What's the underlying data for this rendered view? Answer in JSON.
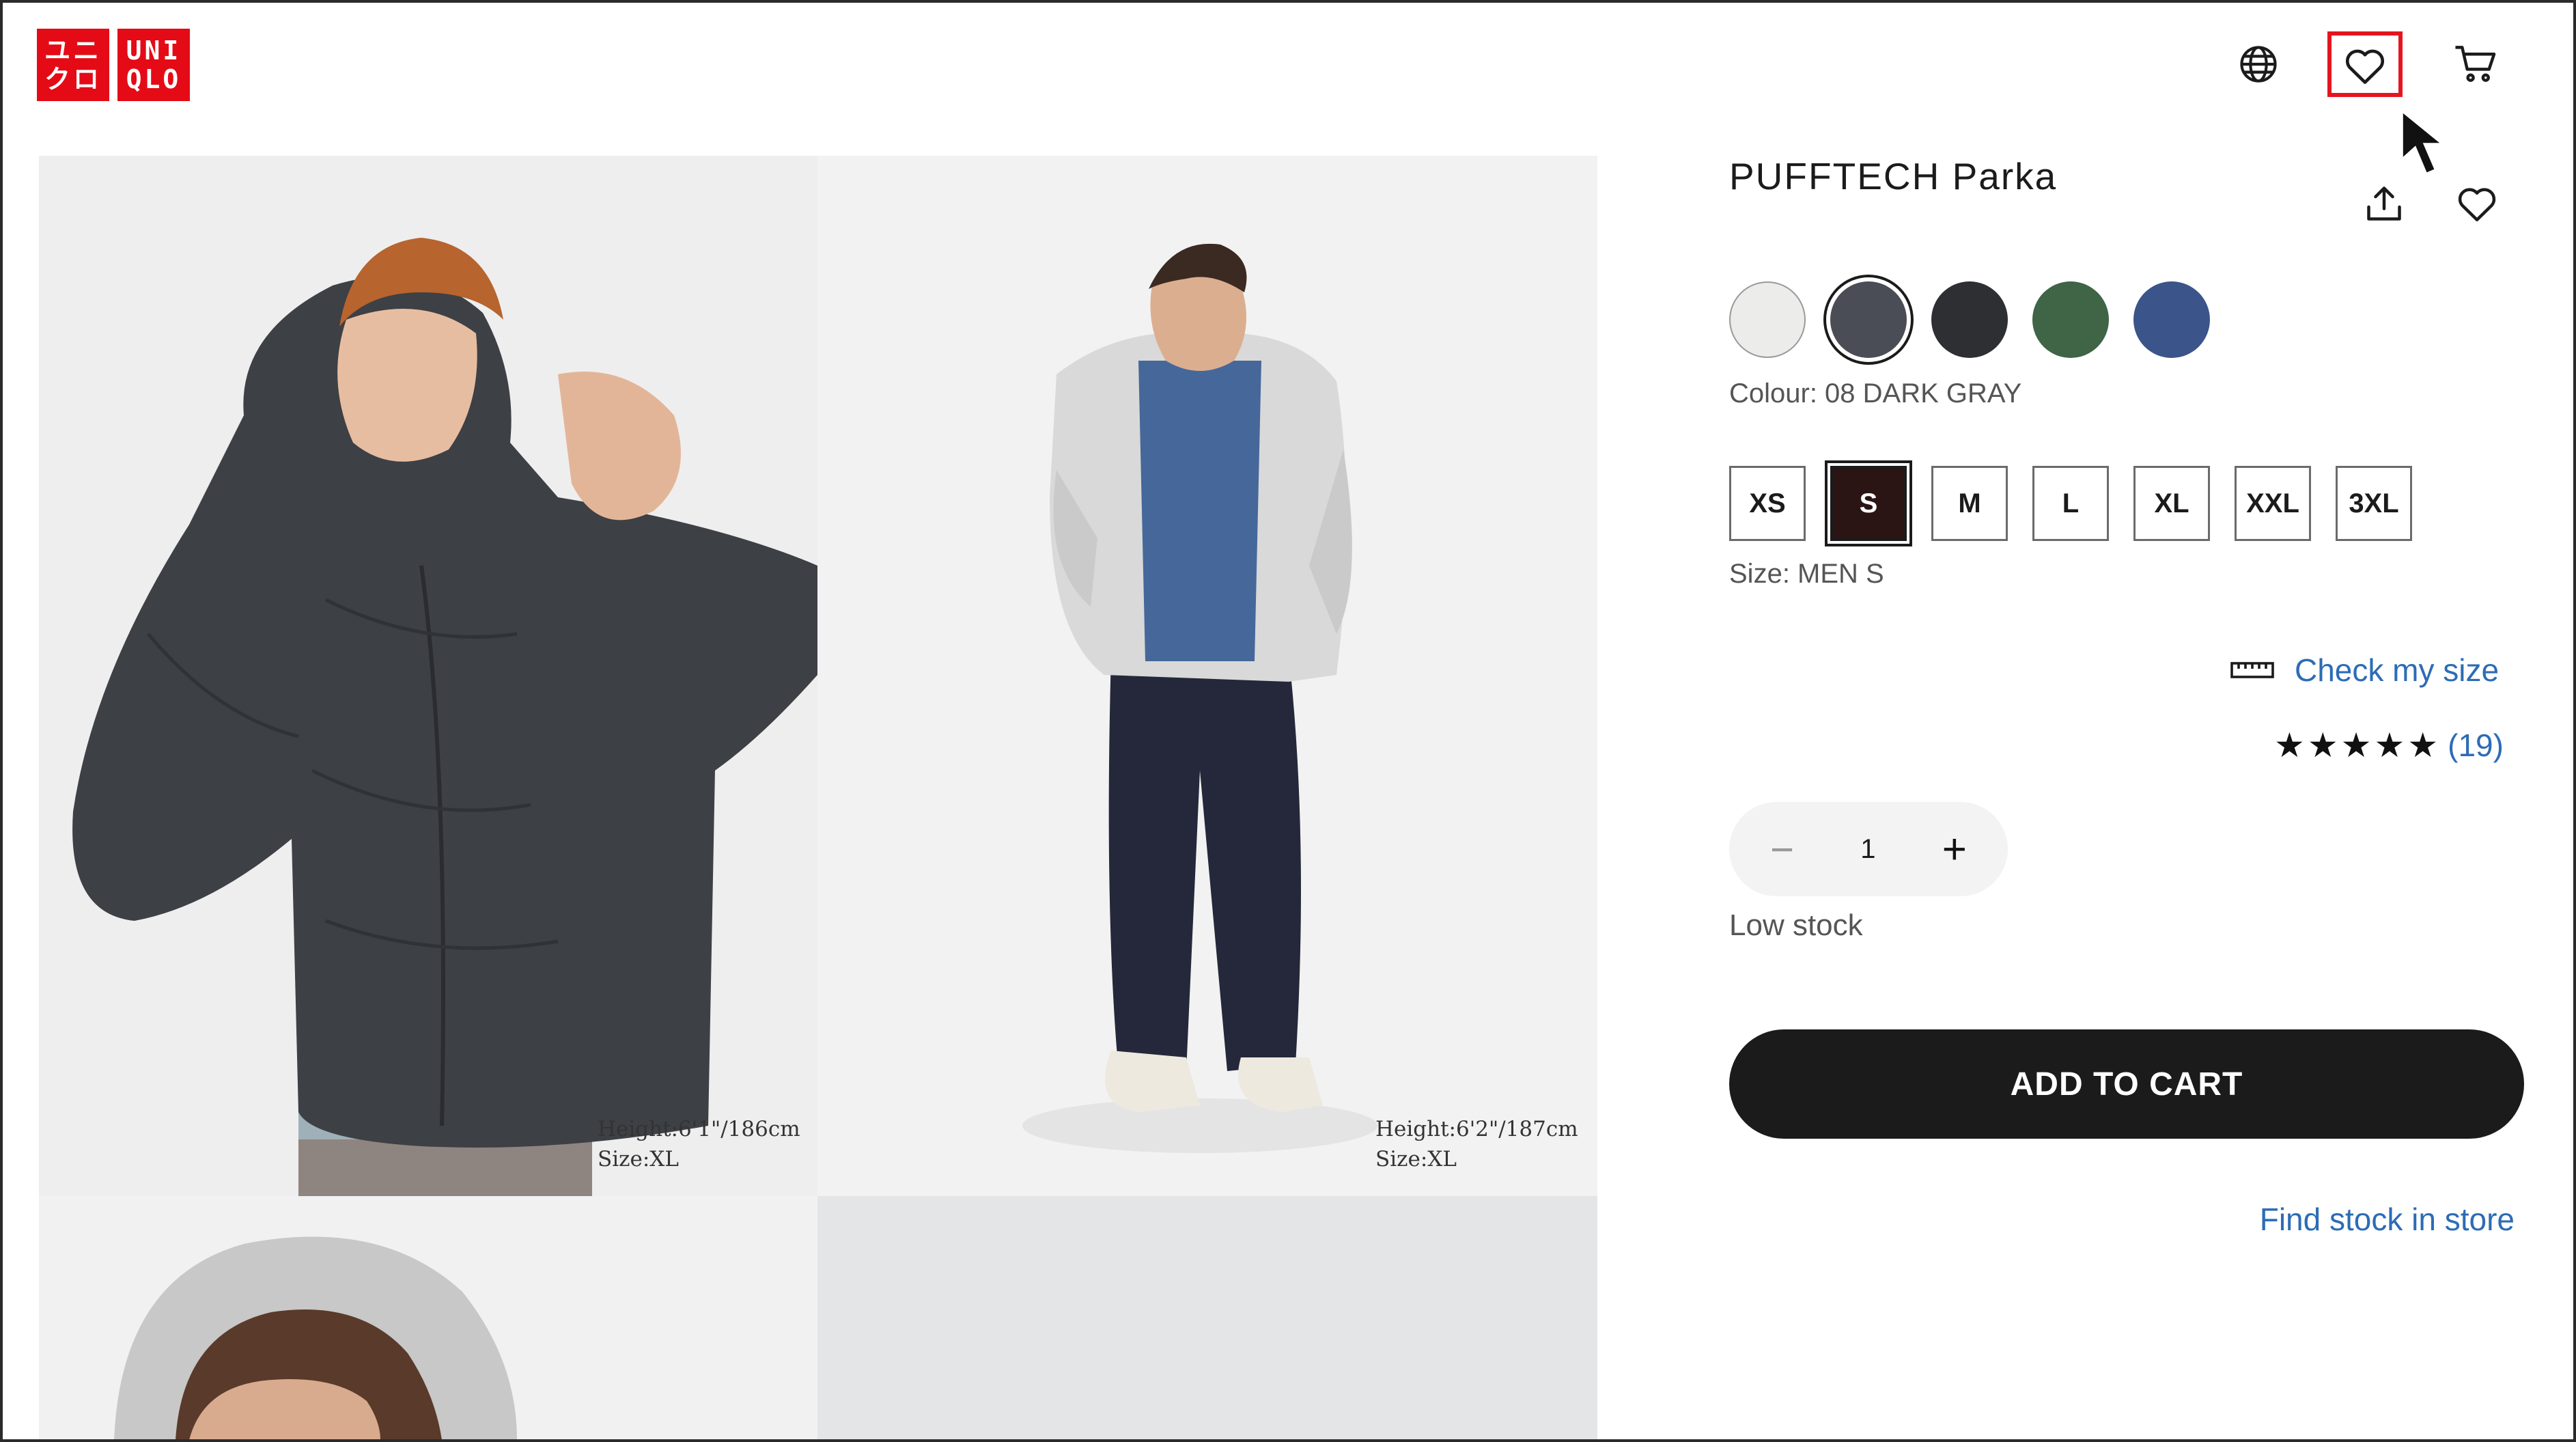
{
  "header": {
    "logo_top": "UNI",
    "logo_bottom": "QLO",
    "logo_top_kana": "ユニ",
    "logo_bottom_kana": "クロ",
    "icons": [
      "globe-icon",
      "heart-icon",
      "cart-icon"
    ],
    "highlight_color": "#e5151f"
  },
  "gallery": {
    "photos": [
      {
        "caption_line1": "Height:6'1\"/186cm",
        "caption_line2": "Size:XL"
      },
      {
        "caption_line1": "Height:6'2\"/187cm",
        "caption_line2": "Size:XL"
      }
    ]
  },
  "product": {
    "title": "PUFFTECH Parka",
    "colours": [
      {
        "name": "off-white",
        "hex": "#ececea"
      },
      {
        "name": "08 DARK GRAY",
        "hex": "#4a4d55",
        "selected": true
      },
      {
        "name": "black",
        "hex": "#2e2f33"
      },
      {
        "name": "green",
        "hex": "#3f6446"
      },
      {
        "name": "blue",
        "hex": "#3b5489"
      }
    ],
    "colour_label": "Colour: 08 DARK GRAY",
    "sizes": [
      "XS",
      "S",
      "M",
      "L",
      "XL",
      "XXL",
      "3XL"
    ],
    "selected_size": "S",
    "size_label": "Size: MEN S",
    "check_size": "Check my size",
    "rating_stars": "★★★★★",
    "rating_count": "(19)",
    "quantity": "1",
    "qty_minus": "−",
    "qty_plus": "+",
    "stock_status": "Low stock",
    "add_to_cart": "ADD TO CART",
    "find_stock": "Find stock in store"
  },
  "colors": {
    "brand_red": "#e40b16",
    "link_blue": "#2d6cb5",
    "button_dark": "#1b1b1b"
  }
}
